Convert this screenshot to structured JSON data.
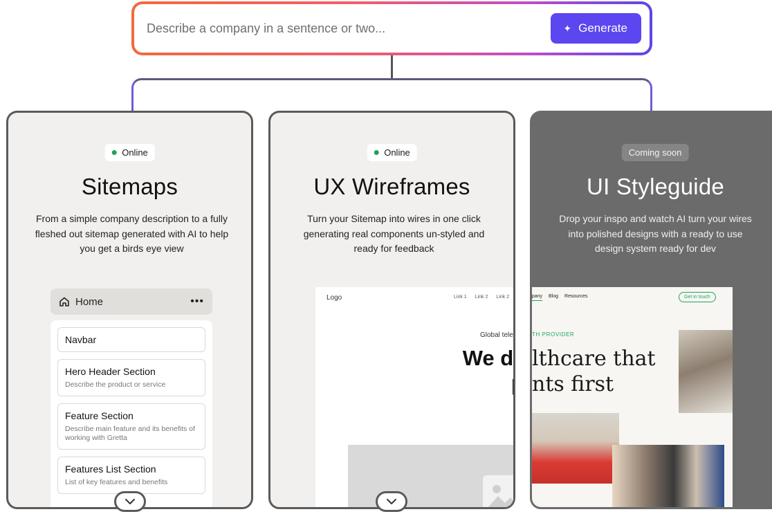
{
  "prompt": {
    "placeholder": "Describe a company in a sentence or two...",
    "generate_label": "Generate"
  },
  "cards": [
    {
      "badge": "Online",
      "title": "Sitemaps",
      "description": "From a simple company description to a fully fleshed out sitemap generated with AI to help you get a birds eye view"
    },
    {
      "badge": "Online",
      "title": "UX Wireframes",
      "description": "Turn your Sitemap into wires in one click generating real components un-styled and ready for feedback"
    },
    {
      "badge": "Coming soon",
      "title": "UI Styleguide",
      "description": "Drop your inspo and watch AI turn your wires into polished designs with a ready to use design system ready for dev"
    }
  ],
  "sitemap": {
    "home_label": "Home",
    "more": "•••",
    "sections": [
      {
        "title": "Navbar",
        "desc": ""
      },
      {
        "title": "Hero Header Section",
        "desc": "Describe the product or service"
      },
      {
        "title": "Feature Section",
        "desc": "Describe main feature and its benefits of working with Gretta"
      },
      {
        "title": "Features List Section",
        "desc": "List of key features and benefits"
      }
    ]
  },
  "wireframe": {
    "logo": "Logo",
    "links": [
      "Link 1",
      "Link 2",
      "Link 2"
    ],
    "kicker": "Global tele",
    "headline_1": "We deliver he",
    "headline_2": "puts pati"
  },
  "styleguide": {
    "nav": [
      "mpany",
      "Blog",
      "Resources"
    ],
    "cta": "Get in touch",
    "kicker": "TH PROVIDER",
    "headline_1": "lthcare that",
    "headline_2": "nts first"
  },
  "colors": {
    "generate": "#5b46f0",
    "online_dot": "#1fa35c",
    "card_bg": "#f1f0ee",
    "card_dark": "#6b6b6b"
  }
}
